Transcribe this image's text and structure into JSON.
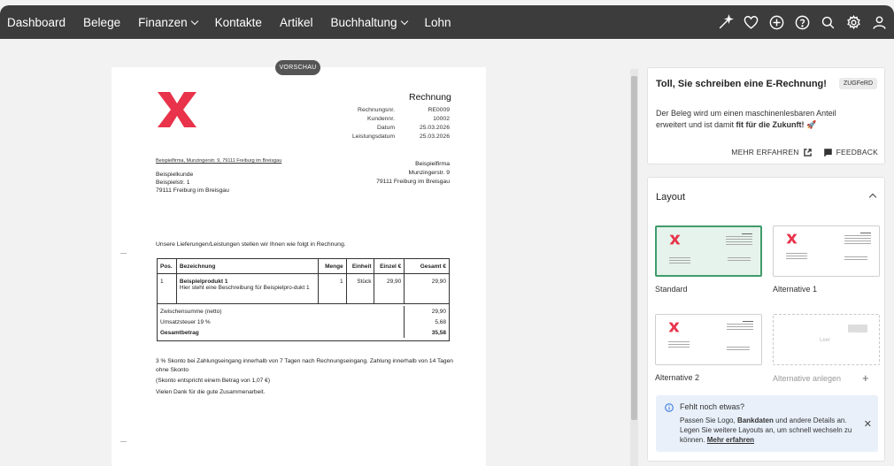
{
  "nav": {
    "items": [
      {
        "label": "Dashboard",
        "dropdown": false
      },
      {
        "label": "Belege",
        "dropdown": false
      },
      {
        "label": "Finanzen",
        "dropdown": true
      },
      {
        "label": "Kontakte",
        "dropdown": false
      },
      {
        "label": "Artikel",
        "dropdown": false
      },
      {
        "label": "Buchhaltung",
        "dropdown": true
      },
      {
        "label": "Lohn",
        "dropdown": false
      }
    ],
    "icons": [
      "magic-wand-icon",
      "heart-icon",
      "plus-circle-icon",
      "help-icon",
      "search-icon",
      "gear-icon",
      "user-icon"
    ]
  },
  "preview": {
    "badge": "VORSCHAU",
    "title": "Rechnung",
    "meta": [
      {
        "key": "Rechnungsnr.",
        "value": "RE0009"
      },
      {
        "key": "Kundennr.",
        "value": "10002"
      },
      {
        "key": "Datum",
        "value": "25.03.2026"
      },
      {
        "key": "Leistungsdatum",
        "value": "25.03.2026"
      }
    ],
    "sender_line": "Beispielfirma, Munzingerstr. 9, 79111 Freiburg im Breisgau",
    "recipient": [
      "Beispielkunde",
      "Beispielstr. 1",
      "79111 Freiburg im Breisgau"
    ],
    "seller": [
      "Beispielfirma",
      "Munzingerstr. 9",
      "79111 Freiburg im Breisgau"
    ],
    "intro": "Unsere Lieferungen/Leistungen stellen wir Ihnen wie folgt in Rechnung.",
    "table": {
      "headers": [
        "Pos.",
        "Bezeichnung",
        "Menge",
        "Einheit",
        "Einzel €",
        "Gesamt €"
      ],
      "row": {
        "pos": "1",
        "name": "Beispielprodukt 1",
        "desc": "Hier steht eine Beschreibung für Beispielpro-dukt 1",
        "qty": "1",
        "unit": "Stück",
        "price": "29,90",
        "total": "29,90"
      },
      "subtotal_label": "Zwischensumme (netto)",
      "subtotal": "29,90",
      "tax_label": "Umsatzsteuer 19 %",
      "tax": "5,68",
      "total_label": "Gesamtbetrag",
      "total": "35,58"
    },
    "notes": [
      "3 % Skonto bei Zahlungseingang innerhalb von 7 Tagen nach Rechnungseingang. Zahlung innerhalb von 14 Tagen ohne Skonto",
      "(Skonto entspricht einem Betrag von 1,07 €)",
      "Vielen Dank für die gute Zusammenarbeit."
    ]
  },
  "einvoice": {
    "title": "Toll, Sie schreiben eine E-Rechnung!",
    "badge": "ZUGFeRD",
    "text_plain": "Der Beleg wird um einen maschinenlesbaren Anteil erweitert und ist damit ",
    "text_bold": "fit für die Zukunft!",
    "text_emoji": "🚀",
    "learn_more": "MEHR ERFAHREN",
    "feedback": "FEEDBACK"
  },
  "layout": {
    "title": "Layout",
    "options": [
      {
        "label": "Standard",
        "selected": true
      },
      {
        "label": "Alternative 1",
        "selected": false
      },
      {
        "label": "Alternative 2",
        "selected": false
      },
      {
        "label": "Alternative anlegen",
        "empty": true,
        "empty_text": "Leer"
      }
    ],
    "info": {
      "title": "Fehlt noch etwas?",
      "text_1": "Passen Sie Logo, ",
      "text_bold": "Bankdaten",
      "text_2": " und andere Details an. Legen Sie weitere Layouts an, um schnell wechseln zu können. ",
      "link": "Mehr erfahren"
    }
  },
  "colors": {
    "nav_bg": "#3c3c3c",
    "logo_red": "#e8334a",
    "selected_green": "#3f9c6b",
    "info_bg": "#e9f0fa"
  }
}
